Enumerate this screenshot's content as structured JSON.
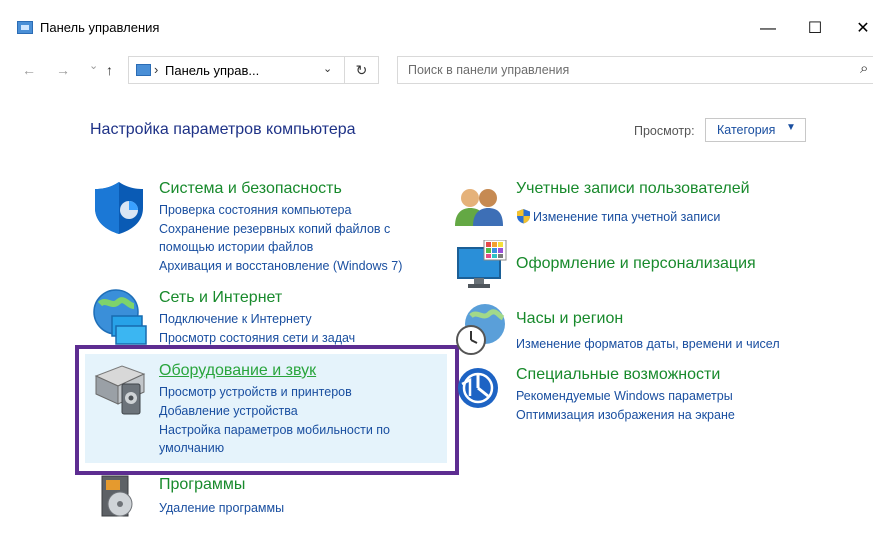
{
  "window": {
    "title": "Панель управления",
    "controls": {
      "minimize": "—",
      "maximize": "☐",
      "close": "✕"
    }
  },
  "nav": {
    "back": "←",
    "forward": "→",
    "recent": "⌄",
    "up": "↑"
  },
  "address": {
    "separator": "›",
    "path": "Панель управ...",
    "dropdown": "⌄",
    "refresh": "↻"
  },
  "search": {
    "placeholder": "Поиск в панели управления"
  },
  "content": {
    "heading": "Настройка параметров компьютера",
    "view_label": "Просмотр:",
    "view_value": "Категория",
    "view_caret": "▼"
  },
  "categories": {
    "system": {
      "title": "Система и безопасность",
      "links": [
        "Проверка состояния компьютера",
        "Сохранение резервных копий файлов с",
        "помощью истории файлов",
        "Архивация и восстановление (Windows 7)"
      ]
    },
    "network": {
      "title": "Сеть и Интернет",
      "links": [
        "Подключение к Интернету",
        "Просмотр состояния сети и задач"
      ]
    },
    "hardware": {
      "title": "Оборудование и звук",
      "links": [
        "Просмотр устройств и принтеров",
        "Добавление устройства",
        "Настройка параметров мобильности по",
        "умолчанию"
      ]
    },
    "programs": {
      "title": "Программы",
      "links": [
        "Удаление программы"
      ]
    },
    "users": {
      "title": "Учетные записи пользователей",
      "links": [
        "Изменение типа учетной записи"
      ]
    },
    "appearance": {
      "title": "Оформление и персонализация",
      "links": []
    },
    "clock": {
      "title": "Часы и регион",
      "links": [
        "Изменение форматов даты, времени и чисел"
      ]
    },
    "access": {
      "title": "Специальные возможности",
      "links": [
        "Рекомендуемые Windows параметры",
        "Оптимизация изображения на экране"
      ]
    }
  },
  "icons": {
    "titlebar": "control-panel-icon",
    "system": "shield-icon",
    "network": "globe-network-icon",
    "hardware": "printer-speaker-icon",
    "programs": "programs-box-icon",
    "users": "users-icon",
    "appearance": "monitor-palette-icon",
    "clock": "clock-globe-icon",
    "access": "accessibility-icon",
    "uac": "uac-shield-icon"
  },
  "colors": {
    "category_title": "#188a2c",
    "link": "#1a4fa0",
    "heading": "#1e3287",
    "highlight": "#e5f3fb",
    "frame": "#5d2d91"
  }
}
